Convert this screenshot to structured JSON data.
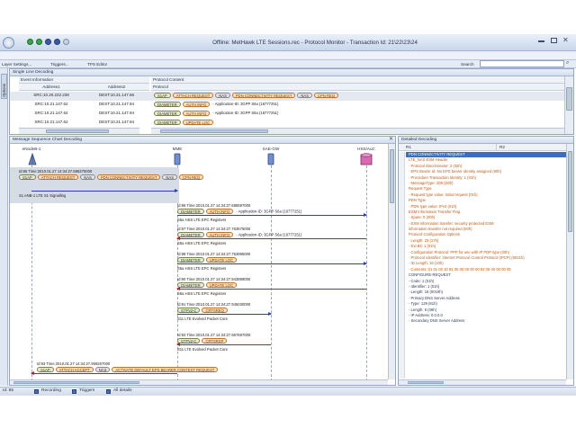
{
  "window": {
    "title": "Offline: MetHawk LTE Sessions.rec - Protocol Monitor - Transaction Id: 21\\22\\23\\24"
  },
  "toolbar": {
    "layer_settings": "Layer Settings...",
    "triggers": "Triggers...",
    "tps_editor": "TPS Editor",
    "search_label": "Search"
  },
  "siderail": {
    "tab_label": "Options"
  },
  "single_line": {
    "title": "Single Line Decoding",
    "event_info_header": "Event Information",
    "address1_header": "Address1",
    "address2_header": "Address2",
    "protocol_content_header": "Protocol Content",
    "protocol_header": "Protocol",
    "rows": [
      {
        "address1": "SRC:10.20.222.228",
        "address2": "DEST:10.21.147.66",
        "tags": [
          "S1AP",
          "ATTACH REQUEST",
          "NAS",
          "PDN CONNECTIVITY REQUEST",
          "NAS",
          "CPN REQ"
        ]
      },
      {
        "address1": "SRC:10.21.147.62",
        "address2": "DEST:10.21.147.94",
        "tags": [
          "DIAMETER",
          "AUTH INFO"
        ],
        "info": "Application-ID: 3GPP S6a (16777251)"
      },
      {
        "address1": "SRC:10.21.147.62",
        "address2": "DEST:10.21.147.94",
        "tags": [
          "DIAMETER",
          "AUTH INFO"
        ],
        "info": "Application-ID: 3GPP S6a (16777251)"
      },
      {
        "address1": "SRC:10.21.147.62",
        "address2": "DEST:10.21.147.94",
        "tags": [
          "DIAMETER",
          "UPDATE LOC"
        ]
      }
    ]
  },
  "msc": {
    "title": "Message Sequence Chart Decoding",
    "nodes": [
      "eNodeB-1",
      "MME",
      "SAE-GW",
      "HSS/AuC"
    ],
    "messages": [
      {
        "id": "Id:85",
        "time": "Time:2010.01.27 14:34:27.686375000",
        "tags": [
          "S1AP",
          "ATTACH REQUEST",
          "NAS",
          "PDN CONNECTIVITY REQUEST",
          "NAS",
          "CPN REQ"
        ],
        "iface": "S1 eNB-1",
        "iface_desc": "LTE S1 Signalling"
      },
      {
        "id": "Id:86",
        "time": "Time:2010.01.27 14:34:27.688597000",
        "tags": [
          "DIAMETER",
          "AUTH INFO"
        ],
        "info": "Application-ID: 3GPP S6a (16777251)",
        "iface": "S6a HSS",
        "iface_desc": "LTE EPC Registers"
      },
      {
        "id": "Id:87",
        "time": "Time:2010.01.27 14:34:27.763575000",
        "tags": [
          "DIAMETER",
          "AUTH INFO"
        ],
        "info": "Application-ID: 3GPP S6a (16777251)",
        "iface": "S6a HSS",
        "iface_desc": "LTE EPC Registers"
      },
      {
        "id": "Id:88",
        "time": "Time:2010.01.27 14:34:27.763995000",
        "tags": [
          "DIAMETER",
          "UPDATE LOC"
        ],
        "iface": "S6a HSS",
        "iface_desc": "LTE EPC Registers"
      },
      {
        "id": "Id:90",
        "time": "Time:2010.01.27 14:34:27.943889000",
        "tags": [
          "DIAMETER",
          "UPDATE LOC"
        ],
        "iface": "S6a HSS",
        "iface_desc": "LTE EPC Registers"
      },
      {
        "id": "Id:91",
        "time": "Time:2010.01.27 14:34:27.945030000",
        "tags": [
          "GTPv2-C",
          "CRTSREQ"
        ],
        "iface": "S11",
        "iface_desc": "LTE Evolved Packet Core"
      },
      {
        "id": "Id:92",
        "time": "Time:2010.01.27 14:34:27.957697000",
        "tags": [
          "GTPv2-C",
          "CRTSRSP"
        ],
        "iface": "S11",
        "iface_desc": "LTE Evolved Packet Core"
      },
      {
        "id": "Id:93",
        "time": "Time:2010.01.27 14:34:27.959267000",
        "tags": [
          "S1AP",
          "ATTACH ACCEPT",
          "NAS",
          "ACTIVATE DEFAULT EPS BEARER CONTEXT REQUEST"
        ]
      }
    ]
  },
  "detail": {
    "title": "Detailed Decoding",
    "col_r1": "R1",
    "col_r2": "R2",
    "rows": [
      {
        "text": "PDN CONNECTIVITY REQUEST",
        "style": "sel"
      },
      {
        "text": "LTE_NAS ESM Header",
        "style": "o"
      },
      {
        "text": "- Protocol Discriminator: 2 (02h)",
        "style": "o"
      },
      {
        "text": "- EPS Bearer Id: No EPS bearer identity assigned (00h)",
        "style": "o"
      },
      {
        "text": "- Procedure Transaction Identity: 1 (01h)",
        "style": "o"
      },
      {
        "text": "- MessageType: 208 (D0h)",
        "style": "o"
      },
      {
        "text": "Request Type",
        "style": "o"
      },
      {
        "text": "- Request type value: Initial request (01h)",
        "style": "o"
      },
      {
        "text": "PDN Type",
        "style": "o"
      },
      {
        "text": "- PDN type value: IPv4 (01h)",
        "style": "o"
      },
      {
        "text": "ESM Information Transfer Flag",
        "style": "o"
      },
      {
        "text": "- Spare: 0 (00h)",
        "style": "o"
      },
      {
        "text": "- ESM information transfer: security protected ESM",
        "style": "o"
      },
      {
        "text": "  information transfer not required (00h)",
        "style": "o"
      },
      {
        "text": "Protocol Configuration Options",
        "style": "o"
      },
      {
        "text": "- Length: 23 (17h)",
        "style": "o"
      },
      {
        "text": "- Ext Bit: 1 (01h)",
        "style": "o"
      },
      {
        "text": "- Configuration Protocol: PPP for use with IP PDP type (00h)",
        "style": "o"
      },
      {
        "text": "- Protocol Identifier: Internet Protocol Control Protocol (IPCP) (8021h)",
        "style": "o"
      },
      {
        "text": "- ID Length: 16 (10h)",
        "style": "o"
      },
      {
        "text": "- Contents: 01 01 00 10 81 06 00 00 00 00 83 06 00 00 00 00",
        "style": "o"
      },
      {
        "text": "CONFIGURE-REQUEST",
        "style": "n"
      },
      {
        "text": "- Code: 1 (01h)",
        "style": "n"
      },
      {
        "text": "- Identifier: 1 (01h)",
        "style": "n"
      },
      {
        "text": "- Length: 16 (0010h)",
        "style": "n"
      },
      {
        "text": "- Primary DNS Server Address",
        "style": "n"
      },
      {
        "text": "  - Type: 129 (81h)",
        "style": "n"
      },
      {
        "text": "  - Length: 6 (06h)",
        "style": "n"
      },
      {
        "text": "  - IP Address: 0.0.0.0",
        "style": "n"
      },
      {
        "text": "- Secondary DNS Server Address",
        "style": "n"
      }
    ]
  },
  "status": {
    "id": "Id: 85",
    "recording": "Recording",
    "triggers": "Triggers",
    "all_details": "All details"
  },
  "colors": {
    "arrow_blue": "#2d3fb8",
    "arrow_red": "#b81e1e",
    "tag_orange": "#c0722a",
    "detail_orange": "#c35a12",
    "selection": "#3d6cc0"
  }
}
